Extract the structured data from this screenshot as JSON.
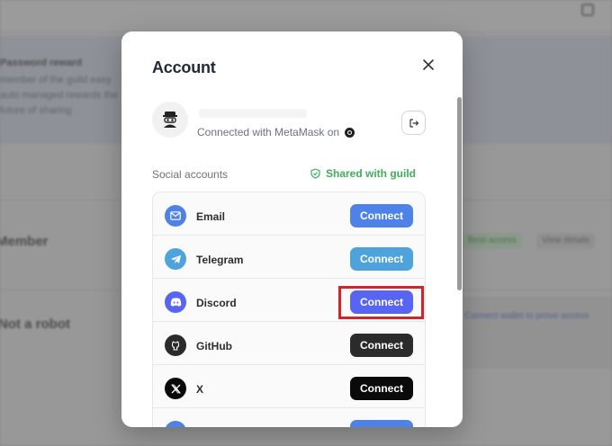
{
  "background": {
    "banner_title": "Password reward",
    "banner_text": "member of the guild easy auto managed rewards the future of sharing",
    "member_section": "Member",
    "robot_section": "Not a robot",
    "chip_green": "Best access",
    "chip_gray": "View details",
    "link_text": "Connect wallet to prove access"
  },
  "modal": {
    "title": "Account",
    "close_icon": "close-icon",
    "wallet": {
      "avatar_icon": "avatar-icon",
      "connected_text": "Connected with MetaMask on",
      "chain_icon": "chain-icon",
      "disconnect_icon": "logout-icon"
    },
    "social": {
      "label": "Social accounts",
      "shared_label": "Shared with guild",
      "shared_icon": "shield-check-icon",
      "accounts": [
        {
          "name": "Email",
          "button": "Connect",
          "icon": "mail-icon",
          "color": "#4f82e6"
        },
        {
          "name": "Telegram",
          "button": "Connect",
          "icon": "telegram-icon",
          "color": "#4fa3dc"
        },
        {
          "name": "Discord",
          "button": "Connect",
          "icon": "discord-icon",
          "color": "#5865f2"
        },
        {
          "name": "GitHub",
          "button": "Connect",
          "icon": "github-icon",
          "color": "#2b2b2b"
        },
        {
          "name": "X",
          "button": "Connect",
          "icon": "x-icon",
          "color": "#0a0a0a"
        },
        {
          "name": "",
          "button": "",
          "icon": "google-icon",
          "color": "#4f82e6"
        }
      ]
    }
  },
  "colors": {
    "shared_green": "#3fae5a",
    "highlight": "#d0262b"
  }
}
